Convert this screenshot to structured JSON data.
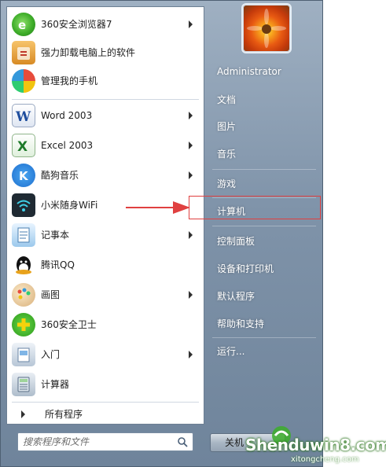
{
  "left_items": [
    {
      "label": "360安全浏览器7",
      "icon": "360-browser-icon",
      "arrow": true
    },
    {
      "label": "强力卸载电脑上的软件",
      "icon": "uninstall-icon",
      "arrow": false
    },
    {
      "label": "管理我的手机",
      "icon": "phone-manager-icon",
      "arrow": false
    },
    {
      "label": "Word 2003",
      "icon": "word-icon",
      "arrow": true
    },
    {
      "label": "Excel 2003",
      "icon": "excel-icon",
      "arrow": true
    },
    {
      "label": "酷狗音乐",
      "icon": "kugou-icon",
      "arrow": true
    },
    {
      "label": "小米随身WiFi",
      "icon": "wifi-icon",
      "arrow": false
    },
    {
      "label": "记事本",
      "icon": "notepad-icon",
      "arrow": true
    },
    {
      "label": "腾讯QQ",
      "icon": "qq-icon",
      "arrow": false
    },
    {
      "label": "画图",
      "icon": "paint-icon",
      "arrow": true
    },
    {
      "label": "360安全卫士",
      "icon": "360-safe-icon",
      "arrow": false
    },
    {
      "label": "入门",
      "icon": "getting-started-icon",
      "arrow": true
    },
    {
      "label": "计算器",
      "icon": "calculator-icon",
      "arrow": false
    }
  ],
  "all_programs": "所有程序",
  "search": {
    "placeholder": "搜索程序和文件"
  },
  "right_items": [
    {
      "label": "Administrator"
    },
    {
      "label": "文档"
    },
    {
      "label": "图片"
    },
    {
      "label": "音乐"
    },
    {
      "label": "游戏"
    },
    {
      "label": "计算机"
    },
    {
      "label": "控制面板"
    },
    {
      "label": "设备和打印机"
    },
    {
      "label": "默认程序"
    },
    {
      "label": "帮助和支持"
    },
    {
      "label": "运行..."
    }
  ],
  "shutdown": {
    "label": "关机"
  },
  "watermark": {
    "main": "Shenduwin8.com",
    "sub": "xitongcheng.com"
  },
  "colors": {
    "accent_red": "#e04040",
    "glass": "#7f93a9"
  }
}
